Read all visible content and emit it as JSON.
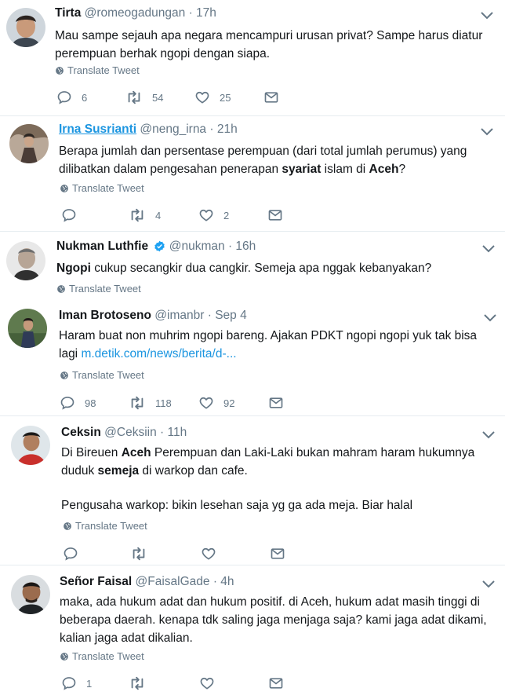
{
  "translate_label": "Translate Tweet",
  "tweets": [
    {
      "name": "Tirta",
      "handle": "@romeogadungan",
      "time": "17h",
      "text_lines": [
        "Mau sampe sejauh apa negara mencampuri urusan privat? Sampe harus diatur",
        "perempuan berhak ngopi dengan siapa."
      ],
      "replies": "6",
      "retweets": "54",
      "likes": "25"
    },
    {
      "name": "Irna Susrianti",
      "handle": "@neng_irna",
      "time": "21h",
      "text_line1": "Berapa jumlah dan persentase perempuan (dari total jumlah perumus) yang",
      "text_line2_a": "dilibatkan dalam pengesahan penerapan ",
      "text_line2_b": "syariat",
      "text_line2_c": " islam di ",
      "text_line2_d": "Aceh",
      "text_line2_e": "?",
      "replies": "",
      "retweets": "4",
      "likes": "2"
    },
    {
      "name": "Nukman Luthfie",
      "handle": "@nukman",
      "time": "16h",
      "text_a": "Ngopi",
      "text_b": " cukup secangkir dua cangkir. Semeja apa nggak kebanyakan?"
    },
    {
      "name": "Iman Brotoseno",
      "handle": "@imanbr",
      "time": "Sep 4",
      "text_line1": "Haram buat non muhrim ngopi bareng. Ajakan PDKT ngopi ngopi yuk tak bisa",
      "text_line2_a": "lagi ",
      "text_line2_link": "m.detik.com/news/berita/d-...",
      "replies": "98",
      "retweets": "118",
      "likes": "92"
    },
    {
      "name": "Ceksin",
      "handle": "@Ceksiin",
      "time": "11h",
      "text_line1_a": "Di Bireuen ",
      "text_line1_b": "Aceh",
      "text_line1_c": " Perempuan dan Laki-Laki bukan mahram haram hukumnya",
      "text_line2_a": "duduk ",
      "text_line2_b": "semeja",
      "text_line2_c": " di warkop dan cafe.",
      "text_line3": "Pengusaha warkop: bikin lesehan saja yg ga ada meja. Biar halal"
    },
    {
      "name": "Señor Faisal",
      "handle": "@FaisalGade",
      "time": "4h",
      "text_lines": [
        "maka, ada hukum adat dan hukum positif. di Aceh, hukum adat masih tinggi di",
        "beberapa daerah. kenapa tdk saling jaga menjaga saja? kami jaga adat dikami,",
        "kalian jaga adat dikalian."
      ],
      "replies": "1"
    }
  ],
  "icons": {
    "reply": "reply-icon",
    "retweet": "retweet-icon",
    "like": "heart-icon",
    "dm": "envelope-icon",
    "translate": "globe-icon",
    "menu": "chevron-down-icon",
    "verified": "verified-badge-icon"
  },
  "colors": {
    "text": "#14171a",
    "secondary": "#657786",
    "link": "#1b95e0",
    "divider": "#e6ecf0"
  }
}
